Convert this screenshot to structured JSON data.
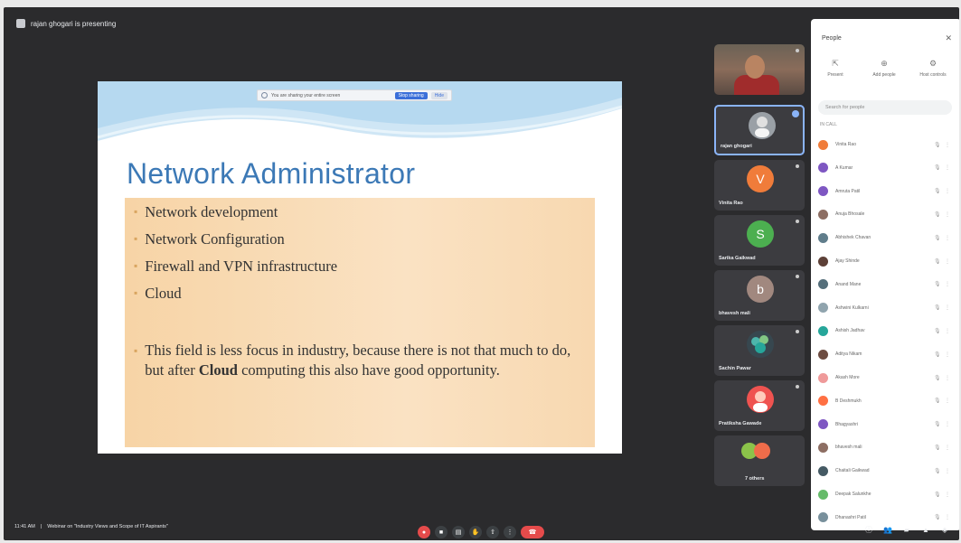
{
  "meeting": {
    "presenter_text": "rajan ghogari is presenting",
    "time": "11:41 AM",
    "meeting_title": "Webinar on \"Industry Views and Scope of IT Aspirants\""
  },
  "share_notice": {
    "message": "You are sharing your entire screen",
    "stop_label": "Stop sharing",
    "hide_label": "Hide"
  },
  "slide": {
    "title": "Network Administrator",
    "bullets": [
      "Network development",
      "Network Configuration",
      "Firewall and VPN infrastructure",
      "Cloud"
    ],
    "note_before": "This field is less focus in industry, because there is not that much to do, but after ",
    "note_bold": "Cloud",
    "note_after": " computing this also have good opportunity.",
    "bullet_color": "#d9a560",
    "title_color": "#3c79b6"
  },
  "tiles": [
    {
      "name": "",
      "kind": "video"
    },
    {
      "name": "rajan ghogari",
      "initial": "",
      "color": "#9aa0a6"
    },
    {
      "name": "Vinita Rao",
      "initial": "V",
      "color": "#f07c3a"
    },
    {
      "name": "Sarika Gaikwad",
      "initial": "S",
      "color": "#4caf50"
    },
    {
      "name": "bhavesh mali",
      "initial": "b",
      "color": "#a1887f"
    },
    {
      "name": "Sachin Pawar",
      "initial": "",
      "color": "#4db6ac"
    },
    {
      "name": "Pratiksha Gawade",
      "initial": "",
      "color": "#ef5350"
    },
    {
      "name": "7 others",
      "initial": "",
      "color": "#ef6c4a"
    }
  ],
  "panel": {
    "title": "People",
    "tabs": [
      "Present",
      "Add people",
      "Host controls"
    ],
    "search_placeholder": "Search for people",
    "in_call_label": "IN CALL",
    "people": [
      {
        "name": "Vinita Rao",
        "color": "#f07c3a"
      },
      {
        "name": "A Kumar",
        "color": "#7e57c2"
      },
      {
        "name": "Amruta Patil",
        "color": "#7e57c2"
      },
      {
        "name": "Anuja Bhosale",
        "color": "#8d6e63"
      },
      {
        "name": "Abhishek Chavan",
        "color": "#607d8b"
      },
      {
        "name": "Ajay Shinde",
        "color": "#5d4037"
      },
      {
        "name": "Anand Mane",
        "color": "#546e7a"
      },
      {
        "name": "Ashwini Kulkarni",
        "color": "#90a4ae"
      },
      {
        "name": "Ashish Jadhav",
        "color": "#26a69a"
      },
      {
        "name": "Aditya Nikam",
        "color": "#6d4c41"
      },
      {
        "name": "Akash More",
        "color": "#ef9a9a"
      },
      {
        "name": "B Deshmukh",
        "color": "#ff7043"
      },
      {
        "name": "Bhagyashri",
        "color": "#7e57c2"
      },
      {
        "name": "bhavesh mali",
        "color": "#8d6e63"
      },
      {
        "name": "Chaitali Gaikwad",
        "color": "#455a64"
      },
      {
        "name": "Deepak Salunkhe",
        "color": "#66bb6a"
      },
      {
        "name": "Dhanashri Patil",
        "color": "#78909c"
      }
    ]
  },
  "controls": {
    "bottom_icons": [
      "microphone-icon",
      "camera-icon",
      "captions-icon",
      "raise-hand-icon",
      "present-icon",
      "more-icon",
      "end-call-icon"
    ],
    "right_icons": [
      "info-icon",
      "people-icon",
      "chat-icon",
      "activities-icon",
      "lock-icon"
    ]
  }
}
